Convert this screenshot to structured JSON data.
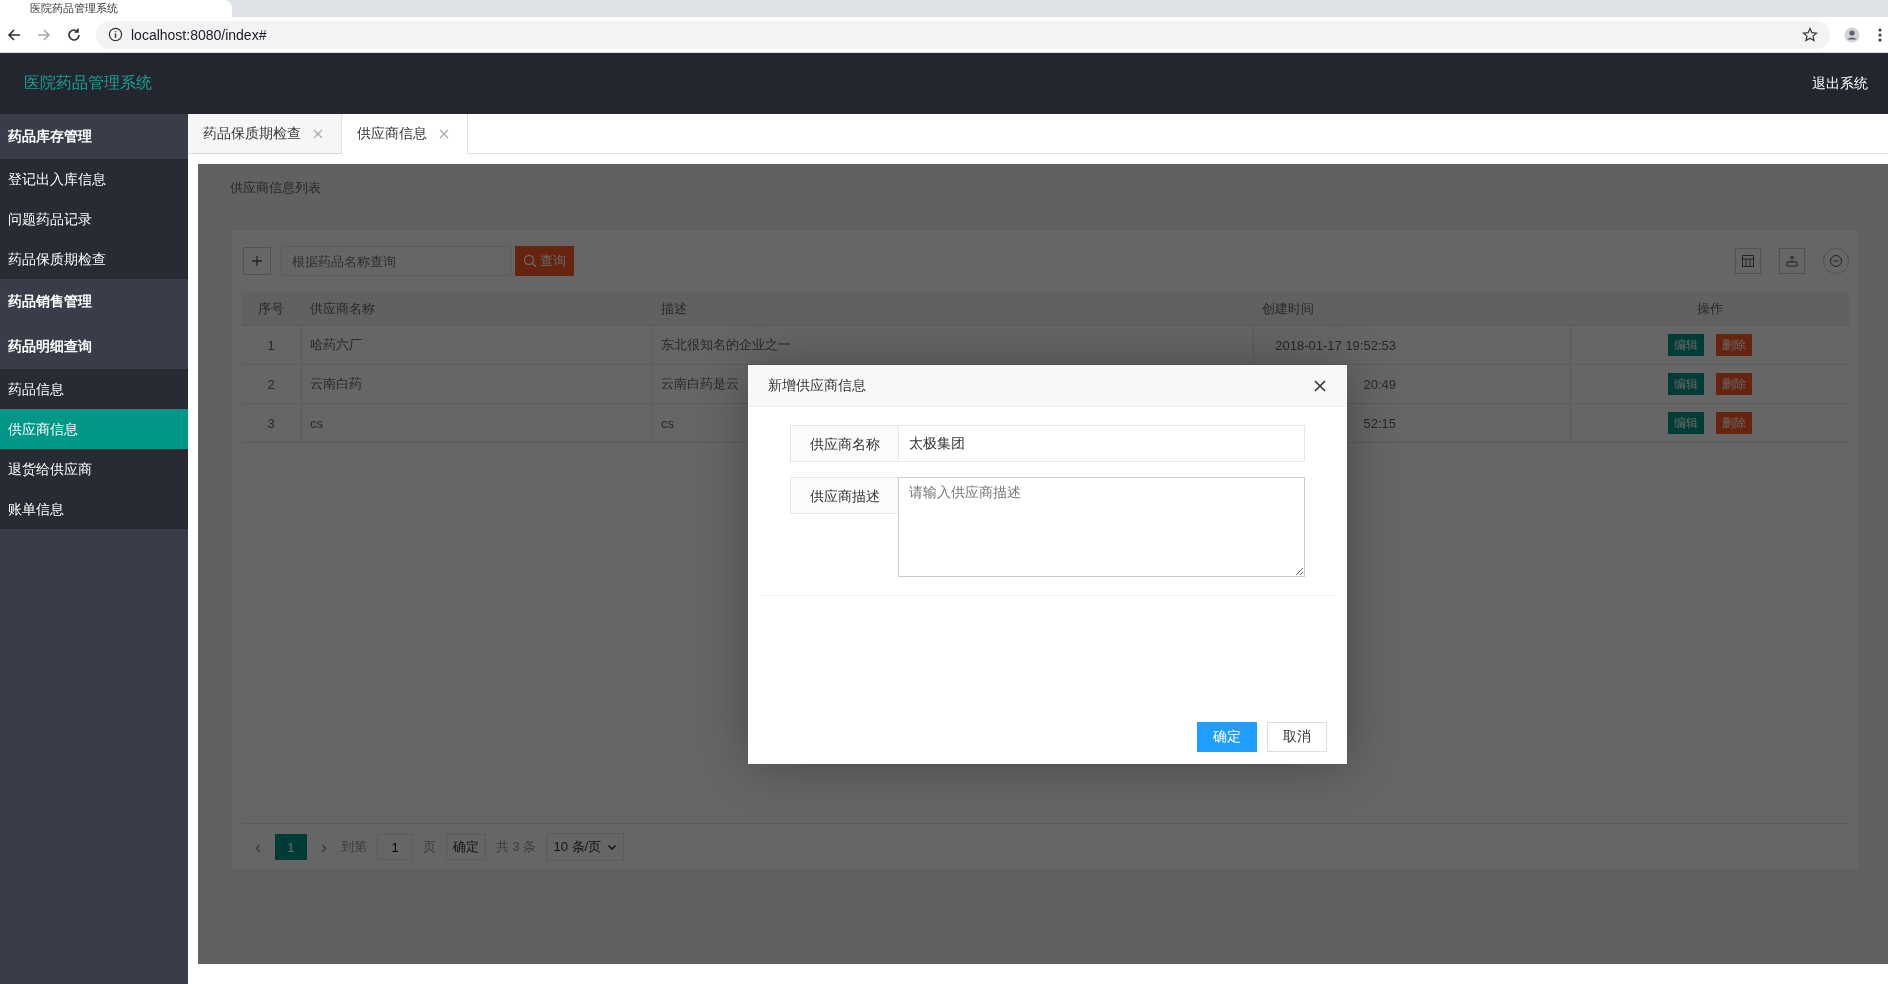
{
  "browser": {
    "tab_title": "医院药品管理系统",
    "url": "localhost:8080/index#"
  },
  "header": {
    "title": "医院药品管理系统",
    "logout": "退出系统"
  },
  "sidebar": {
    "groups": [
      {
        "label": "药品库存管理",
        "children": [
          {
            "label": "登记出入库信息",
            "selected": false
          },
          {
            "label": "问题药品记录",
            "selected": false
          },
          {
            "label": "药品保质期检查",
            "selected": false
          }
        ]
      },
      {
        "label": "药品销售管理"
      },
      {
        "label": "药品明细查询",
        "children": [
          {
            "label": "药品信息",
            "selected": false
          },
          {
            "label": "供应商信息",
            "selected": true
          },
          {
            "label": "退货给供应商",
            "selected": false
          },
          {
            "label": "账单信息",
            "selected": false
          }
        ]
      }
    ]
  },
  "tabs": [
    {
      "label": "药品保质期检查",
      "selected": false
    },
    {
      "label": "供应商信息",
      "selected": true
    }
  ],
  "page_title": "供应商信息列表",
  "toolbar": {
    "search_placeholder": "根据药品名称查询",
    "search_button": "查询"
  },
  "table": {
    "columns": [
      "序号",
      "供应商名称",
      "描述",
      "创建时间",
      "操作"
    ],
    "rows": [
      {
        "index": "1",
        "name": "哈药六厂",
        "description": "东北很知名的企业之一",
        "created": "2018-01-17 19:52:53",
        "actions": [
          "编辑",
          "删除"
        ]
      },
      {
        "index": "2",
        "name": "云南白药",
        "description": "云南白药是云",
        "created": "20:49",
        "actions": [
          "编辑",
          "删除"
        ]
      },
      {
        "index": "3",
        "name": "cs",
        "description": "cs",
        "created": "52:15",
        "actions": [
          "编辑",
          "删除"
        ]
      }
    ]
  },
  "pagination": {
    "prev": "‹",
    "next": "›",
    "pages": [
      {
        "label": "1",
        "selected": true
      }
    ],
    "goto_label": "到第",
    "goto_value": "1",
    "page_unit": "页",
    "confirm": "确定",
    "total": "共 3 条",
    "page_size": "10 条/页"
  },
  "modal": {
    "title": "新增供应商信息",
    "fields": [
      {
        "kind": "text",
        "label": "供应商名称",
        "value": "太极集团"
      },
      {
        "kind": "textarea",
        "label": "供应商描述",
        "placeholder": "请输入供应商描述"
      }
    ],
    "buttons": [
      {
        "kind": "primary",
        "label": "确定"
      },
      {
        "kind": "default",
        "label": "取消"
      }
    ]
  }
}
